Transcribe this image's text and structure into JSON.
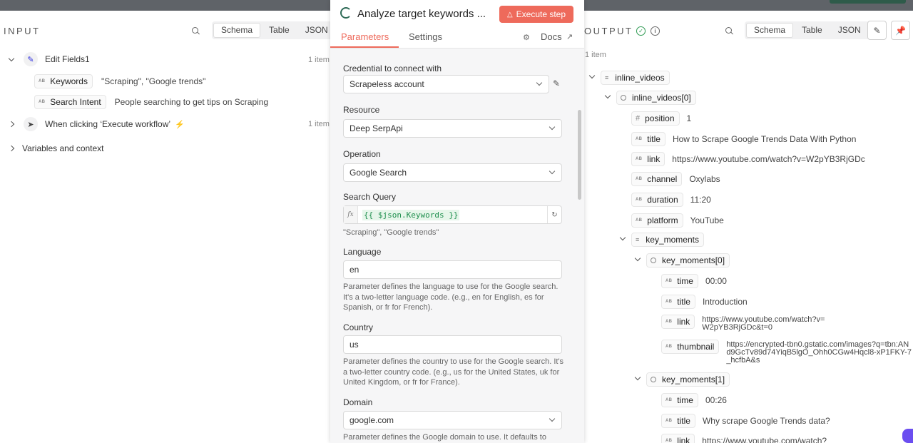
{
  "input": {
    "label": "INPUT",
    "view_tabs": [
      "Schema",
      "Table",
      "JSON"
    ],
    "active_tab": "Schema",
    "nodes": [
      {
        "name": "Edit Fields1",
        "count": "1 item",
        "fields": [
          {
            "key": "Keywords",
            "value": "\"Scraping\", \"Google trends\""
          },
          {
            "key": "Search Intent",
            "value": "People searching to get tips on Scraping"
          }
        ]
      },
      {
        "name": "When clicking ‘Execute workflow’",
        "count": "1 item"
      }
    ],
    "variables_label": "Variables and context"
  },
  "modal": {
    "title": "Analyze target keywords ...",
    "execute_label": "Execute step",
    "tabs": [
      "Parameters",
      "Settings"
    ],
    "docs_label": "Docs",
    "fields": {
      "credential_label": "Credential to connect with",
      "credential_value": "Scrapeless account",
      "resource_label": "Resource",
      "resource_value": "Deep SerpApi",
      "operation_label": "Operation",
      "operation_value": "Google Search",
      "query_label": "Search Query",
      "query_expression": "{{ $json.Keywords }}",
      "query_result": "\"Scraping\", \"Google trends\"",
      "language_label": "Language",
      "language_value": "en",
      "language_hint": "Parameter defines the language to use for the Google search. It's a two-letter language code. (e.g., en for English, es for Spanish, or fr for French).",
      "country_label": "Country",
      "country_value": "us",
      "country_hint": "Parameter defines the country to use for the Google search. It's a two-letter country code. (e.g., us for the United States, uk for United Kingdom, or fr for France).",
      "domain_label": "Domain",
      "domain_value": "google.com",
      "domain_hint": "Parameter defines the Google domain to use. It defaults to"
    }
  },
  "output": {
    "label": "OUTPUT",
    "view_tabs": [
      "Schema",
      "Table",
      "JSON"
    ],
    "active_tab": "Schema",
    "count": "1 item",
    "rows": [
      {
        "type": "list",
        "key": "inline_videos",
        "value": ""
      },
      {
        "type": "object",
        "key": "inline_videos[0]",
        "value": ""
      },
      {
        "type": "number",
        "key": "position",
        "value": "1"
      },
      {
        "type": "string",
        "key": "title",
        "value": "How to Scrape Google Trends Data With Python"
      },
      {
        "type": "string",
        "key": "link",
        "value": "https://www.youtube.com/watch?v=W2pYB3RjGDc"
      },
      {
        "type": "string",
        "key": "channel",
        "value": "Oxylabs"
      },
      {
        "type": "string",
        "key": "duration",
        "value": "11:20"
      },
      {
        "type": "string",
        "key": "platform",
        "value": "YouTube"
      },
      {
        "type": "list",
        "key": "key_moments",
        "value": ""
      },
      {
        "type": "object",
        "key": "key_moments[0]",
        "value": ""
      },
      {
        "type": "string",
        "key": "time",
        "value": "00:00"
      },
      {
        "type": "string",
        "key": "title",
        "value": "Introduction"
      },
      {
        "type": "string",
        "key": "link",
        "value": "https://www.youtube.com/watch?v=W2pYB3RjGDc&t=0"
      },
      {
        "type": "string",
        "key": "thumbnail",
        "value": "https://encrypted-tbn0.gstatic.com/images?q=tbn:ANd9GcTv89d74YiqB5lgO_Ohh0CGw4Hqcl8-xP1FKY-7_hcfbA&s"
      },
      {
        "type": "object",
        "key": "key_moments[1]",
        "value": ""
      },
      {
        "type": "string",
        "key": "time",
        "value": "00:26"
      },
      {
        "type": "string",
        "key": "title",
        "value": "Why scrape Google Trends data?"
      },
      {
        "type": "string",
        "key": "link",
        "value": "https://www.youtube.com/watch?"
      }
    ]
  },
  "icons": {
    "string": "AB",
    "number": "#",
    "colors": {
      "accent": "#ee6a5b",
      "success": "#2e9a52",
      "node": "#2f2fe0",
      "expr": "#1f8f4e"
    }
  }
}
